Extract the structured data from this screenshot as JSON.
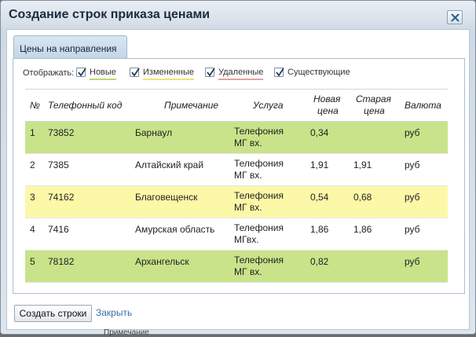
{
  "dialog": {
    "title": "Создание строк приказа ценами",
    "tab_label": "Цены на направления"
  },
  "filter": {
    "label": "Отображать:",
    "options": [
      {
        "label": "Новые",
        "checked": true,
        "underline_color": "#b9d870"
      },
      {
        "label": "Измененные",
        "checked": true,
        "underline_color": "#f0e278"
      },
      {
        "label": "Удаленные",
        "checked": true,
        "underline_color": "#e4a2a0"
      },
      {
        "label": "Существующие",
        "checked": true
      }
    ]
  },
  "table": {
    "headers": {
      "num": "№",
      "code": "Телефонный код",
      "note": "Примечание",
      "service": "Услуга",
      "new_price_1": "Новая",
      "new_price_2": "цена",
      "old_price_1": "Старая",
      "old_price_2": "цена",
      "currency": "Валюта"
    },
    "rows": [
      {
        "num": "1",
        "code": "73852",
        "note": "Барнаул",
        "service": "Телефония МГ вх.",
        "new_price": "0,34",
        "old_price": "",
        "currency": "руб",
        "status": "new",
        "bg": "#c9e38a"
      },
      {
        "num": "2",
        "code": "7385",
        "note": "Алтайский край",
        "service": "Телефония МГ вх.",
        "new_price": "1,91",
        "old_price": "1,91",
        "currency": "руб",
        "status": "existing",
        "bg": "#ffffff"
      },
      {
        "num": "3",
        "code": "74162",
        "note": "Благовещенск",
        "service": "Телефония МГ вх.",
        "new_price": "0,54",
        "old_price": "0,68",
        "currency": "руб",
        "status": "changed",
        "bg": "#fdf8a8"
      },
      {
        "num": "4",
        "code": "7416",
        "note": "Амурская область",
        "service": "Телефония МГвх.",
        "new_price": "1,86",
        "old_price": "1,86",
        "currency": "руб",
        "status": "existing",
        "bg": "#ffffff"
      },
      {
        "num": "5",
        "code": "78182",
        "note": "Архангельск",
        "service": "Телефония МГ вх.",
        "new_price": "0,82",
        "old_price": "",
        "currency": "руб",
        "status": "new",
        "bg": "#c9e38a"
      }
    ]
  },
  "footer": {
    "create_button": "Создать строки",
    "close_link": "Закрыть"
  },
  "background": {
    "partial_text": "Примечание"
  },
  "icons": {
    "close": "close-icon",
    "checkbox": "checkmark-icon"
  }
}
